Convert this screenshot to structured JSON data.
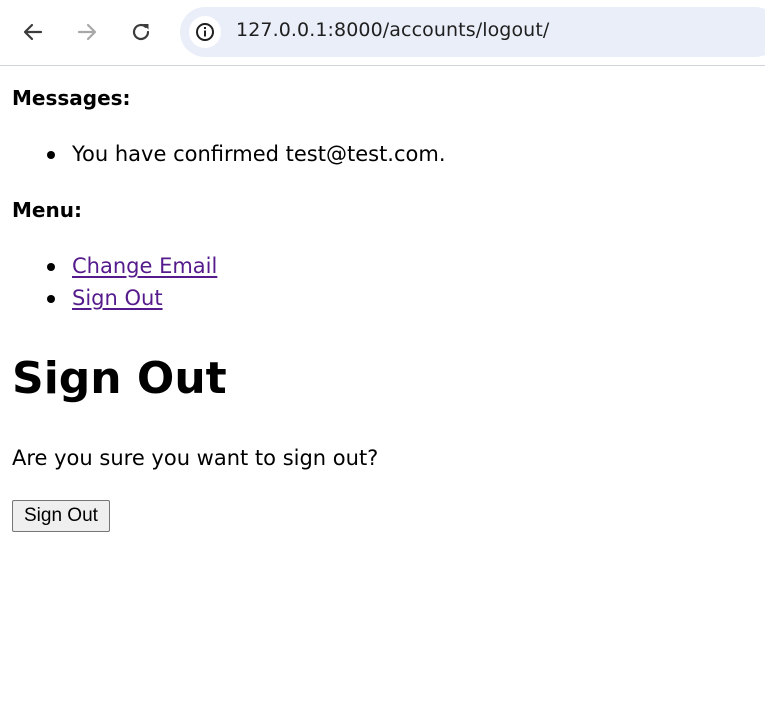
{
  "browser": {
    "url": "127.0.0.1:8000/accounts/logout/",
    "icons": {
      "back": "arrow-left-icon",
      "forward": "arrow-right-icon",
      "reload": "reload-icon",
      "site_info": "info-icon"
    }
  },
  "messages": {
    "heading": "Messages:",
    "items": [
      "You have confirmed test@test.com."
    ]
  },
  "menu": {
    "heading": "Menu:",
    "items": [
      {
        "label": "Change Email"
      },
      {
        "label": "Sign Out"
      }
    ],
    "link_color": "#551a8b"
  },
  "main": {
    "title": "Sign Out",
    "prompt": "Are you sure you want to sign out?",
    "submit_label": "Sign Out"
  }
}
